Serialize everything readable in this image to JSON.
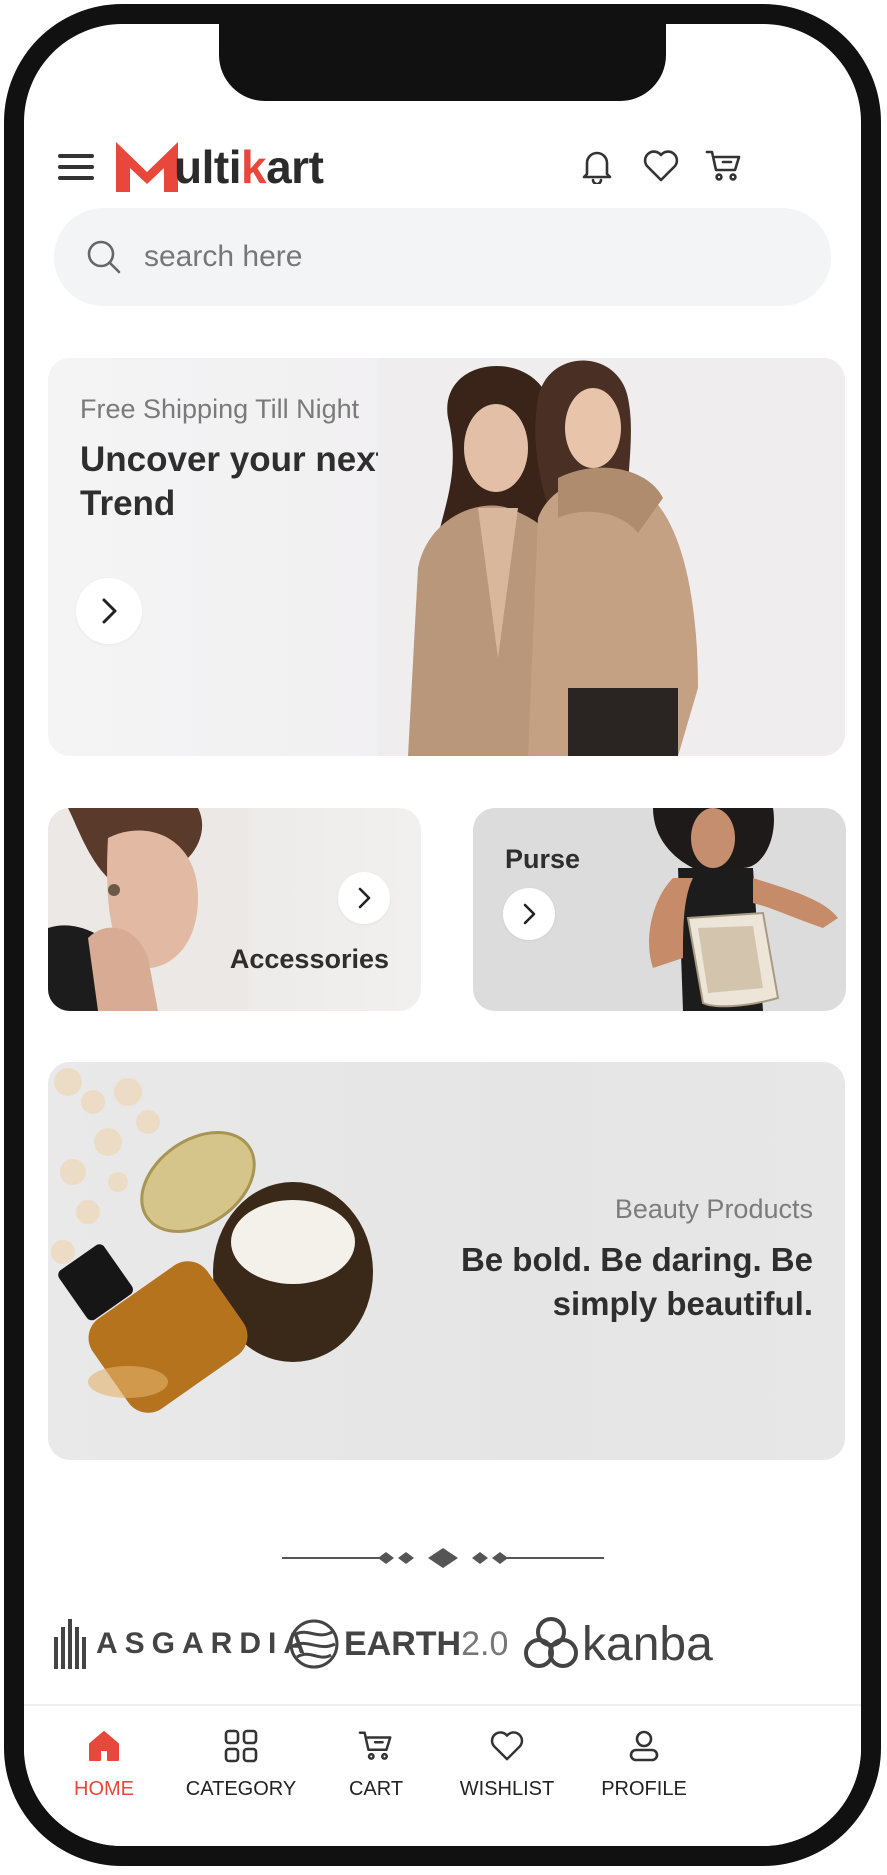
{
  "colors": {
    "accent": "#e8473c",
    "text": "#2e2e2e",
    "muted": "#7a7a7a",
    "search_bg": "#f3f4f6"
  },
  "header": {
    "logo_rest_1": "ulti",
    "logo_accent": "k",
    "logo_rest_2": "art",
    "icons": [
      "menu-icon",
      "bell-icon",
      "heart-icon",
      "cart-icon"
    ]
  },
  "search": {
    "placeholder": "search here",
    "value": ""
  },
  "hero": {
    "subtitle": "Free Shipping Till Night",
    "title": "Uncover your next Trend"
  },
  "categories": [
    {
      "label": "Accessories"
    },
    {
      "label": "Purse"
    }
  ],
  "beauty": {
    "subtitle": "Beauty Products",
    "title": "Be bold. Be daring. Be simply beautiful."
  },
  "brands": [
    {
      "name": "ASGARDIA"
    },
    {
      "name_main": "EARTH",
      "name_ver": "2.0"
    },
    {
      "name": "kanba"
    }
  ],
  "nav": [
    {
      "label": "HOME",
      "icon": "home-icon",
      "active": true
    },
    {
      "label": "CATEGORY",
      "icon": "grid-icon"
    },
    {
      "label": "CART",
      "icon": "cart-icon"
    },
    {
      "label": "WISHLIST",
      "icon": "heart-icon"
    },
    {
      "label": "PROFILE",
      "icon": "user-icon"
    }
  ]
}
